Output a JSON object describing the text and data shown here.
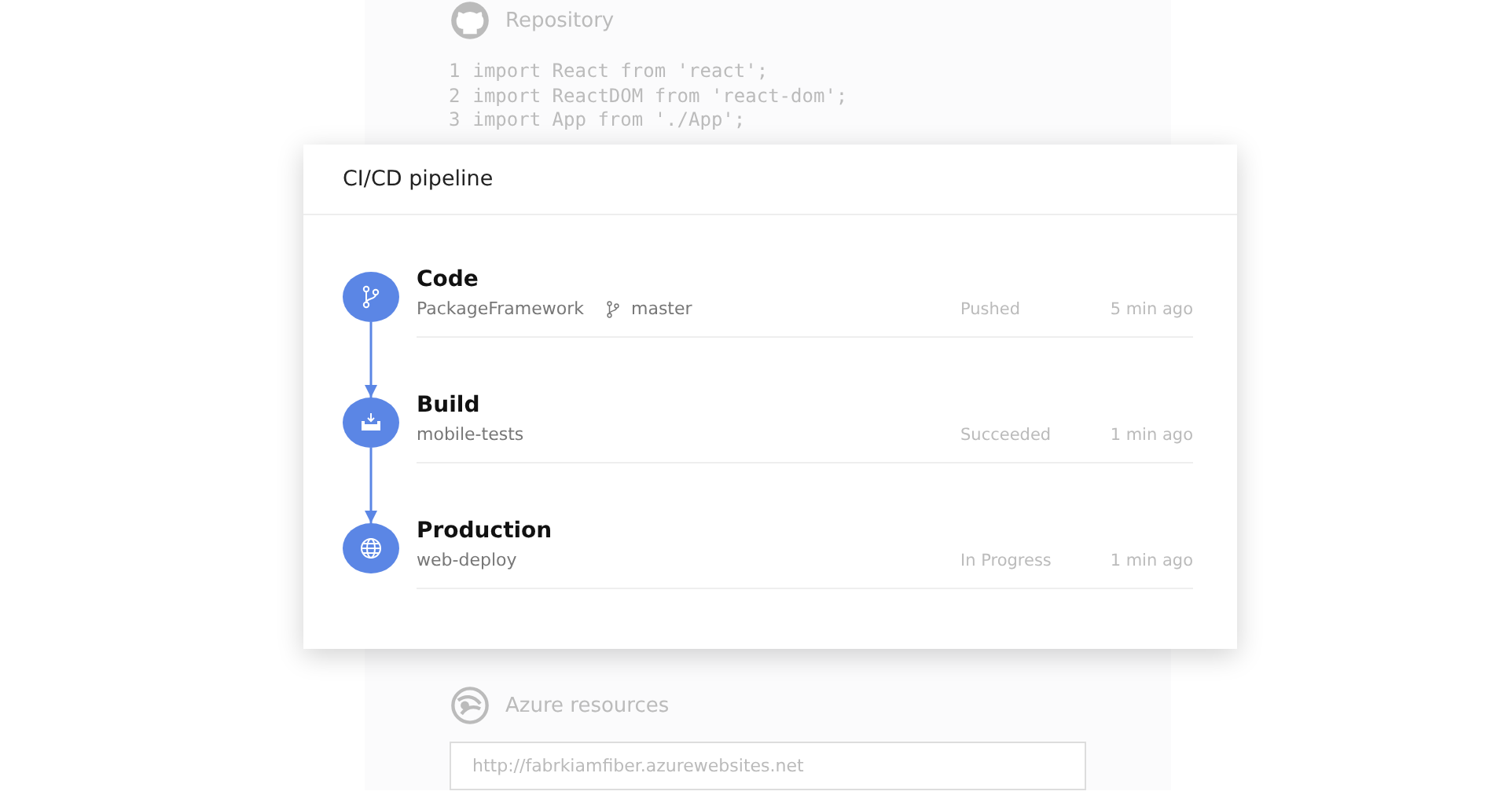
{
  "repository": {
    "title": "Repository",
    "code_lines": [
      {
        "number": "1",
        "text": "import React from 'react';"
      },
      {
        "number": "2",
        "text": "import ReactDOM from 'react-dom';"
      },
      {
        "number": "3",
        "text": "import App from './App';"
      }
    ]
  },
  "pipeline": {
    "title": "CI/CD pipeline",
    "steps": [
      {
        "kind": "code",
        "name": "Code",
        "source": "PackageFramework",
        "branch": "master",
        "status": "Pushed",
        "time": "5 min ago"
      },
      {
        "kind": "build",
        "name": "Build",
        "source": "mobile-tests",
        "status": "Succeeded",
        "time": "1 min ago"
      },
      {
        "kind": "deploy",
        "name": "Production",
        "source": "web-deploy",
        "status": "In Progress",
        "time": "1 min ago"
      }
    ]
  },
  "azure": {
    "title": "Azure resources",
    "url": "http://fabrkiamfiber.azurewebsites.net"
  }
}
